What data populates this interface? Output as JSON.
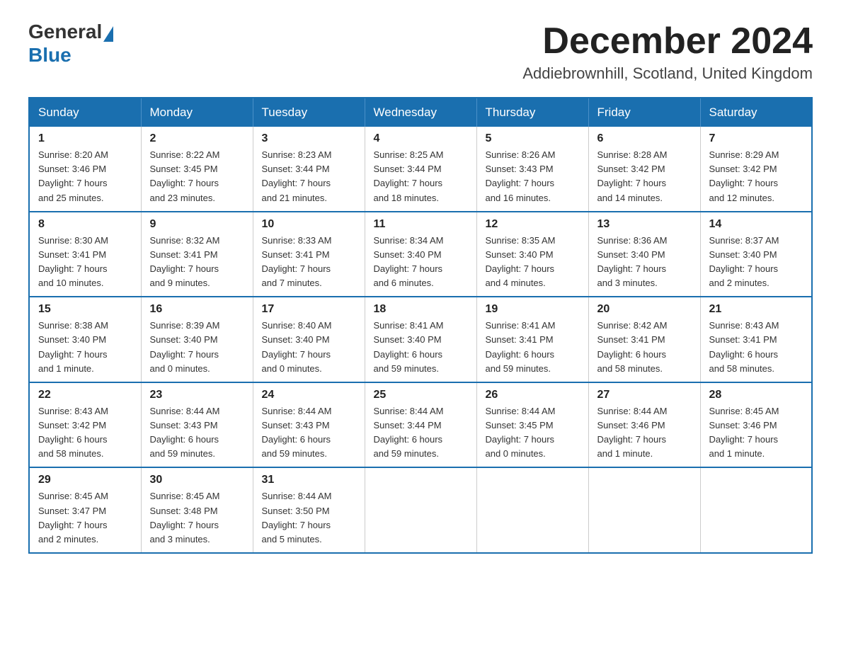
{
  "logo": {
    "general": "General",
    "blue": "Blue"
  },
  "title": "December 2024",
  "location": "Addiebrownhill, Scotland, United Kingdom",
  "headers": [
    "Sunday",
    "Monday",
    "Tuesday",
    "Wednesday",
    "Thursday",
    "Friday",
    "Saturday"
  ],
  "weeks": [
    [
      {
        "day": "1",
        "info": "Sunrise: 8:20 AM\nSunset: 3:46 PM\nDaylight: 7 hours\nand 25 minutes."
      },
      {
        "day": "2",
        "info": "Sunrise: 8:22 AM\nSunset: 3:45 PM\nDaylight: 7 hours\nand 23 minutes."
      },
      {
        "day": "3",
        "info": "Sunrise: 8:23 AM\nSunset: 3:44 PM\nDaylight: 7 hours\nand 21 minutes."
      },
      {
        "day": "4",
        "info": "Sunrise: 8:25 AM\nSunset: 3:44 PM\nDaylight: 7 hours\nand 18 minutes."
      },
      {
        "day": "5",
        "info": "Sunrise: 8:26 AM\nSunset: 3:43 PM\nDaylight: 7 hours\nand 16 minutes."
      },
      {
        "day": "6",
        "info": "Sunrise: 8:28 AM\nSunset: 3:42 PM\nDaylight: 7 hours\nand 14 minutes."
      },
      {
        "day": "7",
        "info": "Sunrise: 8:29 AM\nSunset: 3:42 PM\nDaylight: 7 hours\nand 12 minutes."
      }
    ],
    [
      {
        "day": "8",
        "info": "Sunrise: 8:30 AM\nSunset: 3:41 PM\nDaylight: 7 hours\nand 10 minutes."
      },
      {
        "day": "9",
        "info": "Sunrise: 8:32 AM\nSunset: 3:41 PM\nDaylight: 7 hours\nand 9 minutes."
      },
      {
        "day": "10",
        "info": "Sunrise: 8:33 AM\nSunset: 3:41 PM\nDaylight: 7 hours\nand 7 minutes."
      },
      {
        "day": "11",
        "info": "Sunrise: 8:34 AM\nSunset: 3:40 PM\nDaylight: 7 hours\nand 6 minutes."
      },
      {
        "day": "12",
        "info": "Sunrise: 8:35 AM\nSunset: 3:40 PM\nDaylight: 7 hours\nand 4 minutes."
      },
      {
        "day": "13",
        "info": "Sunrise: 8:36 AM\nSunset: 3:40 PM\nDaylight: 7 hours\nand 3 minutes."
      },
      {
        "day": "14",
        "info": "Sunrise: 8:37 AM\nSunset: 3:40 PM\nDaylight: 7 hours\nand 2 minutes."
      }
    ],
    [
      {
        "day": "15",
        "info": "Sunrise: 8:38 AM\nSunset: 3:40 PM\nDaylight: 7 hours\nand 1 minute."
      },
      {
        "day": "16",
        "info": "Sunrise: 8:39 AM\nSunset: 3:40 PM\nDaylight: 7 hours\nand 0 minutes."
      },
      {
        "day": "17",
        "info": "Sunrise: 8:40 AM\nSunset: 3:40 PM\nDaylight: 7 hours\nand 0 minutes."
      },
      {
        "day": "18",
        "info": "Sunrise: 8:41 AM\nSunset: 3:40 PM\nDaylight: 6 hours\nand 59 minutes."
      },
      {
        "day": "19",
        "info": "Sunrise: 8:41 AM\nSunset: 3:41 PM\nDaylight: 6 hours\nand 59 minutes."
      },
      {
        "day": "20",
        "info": "Sunrise: 8:42 AM\nSunset: 3:41 PM\nDaylight: 6 hours\nand 58 minutes."
      },
      {
        "day": "21",
        "info": "Sunrise: 8:43 AM\nSunset: 3:41 PM\nDaylight: 6 hours\nand 58 minutes."
      }
    ],
    [
      {
        "day": "22",
        "info": "Sunrise: 8:43 AM\nSunset: 3:42 PM\nDaylight: 6 hours\nand 58 minutes."
      },
      {
        "day": "23",
        "info": "Sunrise: 8:44 AM\nSunset: 3:43 PM\nDaylight: 6 hours\nand 59 minutes."
      },
      {
        "day": "24",
        "info": "Sunrise: 8:44 AM\nSunset: 3:43 PM\nDaylight: 6 hours\nand 59 minutes."
      },
      {
        "day": "25",
        "info": "Sunrise: 8:44 AM\nSunset: 3:44 PM\nDaylight: 6 hours\nand 59 minutes."
      },
      {
        "day": "26",
        "info": "Sunrise: 8:44 AM\nSunset: 3:45 PM\nDaylight: 7 hours\nand 0 minutes."
      },
      {
        "day": "27",
        "info": "Sunrise: 8:44 AM\nSunset: 3:46 PM\nDaylight: 7 hours\nand 1 minute."
      },
      {
        "day": "28",
        "info": "Sunrise: 8:45 AM\nSunset: 3:46 PM\nDaylight: 7 hours\nand 1 minute."
      }
    ],
    [
      {
        "day": "29",
        "info": "Sunrise: 8:45 AM\nSunset: 3:47 PM\nDaylight: 7 hours\nand 2 minutes."
      },
      {
        "day": "30",
        "info": "Sunrise: 8:45 AM\nSunset: 3:48 PM\nDaylight: 7 hours\nand 3 minutes."
      },
      {
        "day": "31",
        "info": "Sunrise: 8:44 AM\nSunset: 3:50 PM\nDaylight: 7 hours\nand 5 minutes."
      },
      null,
      null,
      null,
      null
    ]
  ]
}
